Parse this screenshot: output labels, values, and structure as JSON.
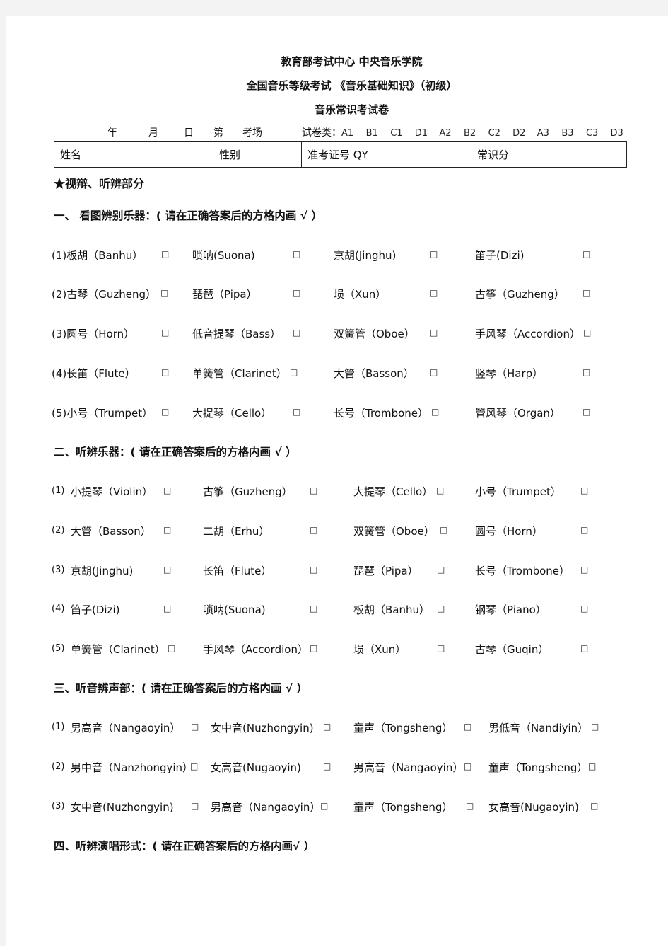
{
  "header": {
    "line1": "教育部考试中心  中央音乐学院",
    "line2": "全国音乐等级考试  《音乐基础知识》（初级）",
    "line3": "音乐常识考试卷"
  },
  "meta": {
    "year": "年",
    "month": "月",
    "day": "日",
    "di": "第",
    "exam_room": "考场",
    "paper_type_label": "试卷类：",
    "paper_codes": [
      "A1",
      "B1",
      "C1",
      "D1",
      "A2",
      "B2",
      "C2",
      "D2",
      "A3",
      "B3",
      "C3",
      "D3"
    ]
  },
  "info_table": {
    "name": "姓名",
    "gender": "性别",
    "ticket": "准考证号 QY",
    "score": "常识分"
  },
  "section_star": "★视辩、听辨部分",
  "checkbox": "□",
  "sections": [
    {
      "title": "一、 看图辨别乐器：( 请在正确答案后的方格内画  √  ）",
      "rows": [
        {
          "num": "(1)",
          "items": [
            "板胡（Banhu）",
            "唢呐(Suona)",
            "京胡(Jinghu)",
            "笛子(Dizi)"
          ]
        },
        {
          "num": "(2)",
          "items": [
            "古琴（Guzheng）",
            "琵琶（Pipa）",
            "埙（Xun）",
            "古筝（Guzheng）"
          ]
        },
        {
          "num": "(3)",
          "items": [
            "圆号（Horn）",
            "低音提琴（Bass）",
            "双簧管（Oboe）",
            "手风琴（Accordion）"
          ]
        },
        {
          "num": "(4)",
          "items": [
            "长笛（Flute）",
            "单簧管（Clarinet）",
            "大管（Basson）",
            "竖琴（Harp）"
          ]
        },
        {
          "num": "(5)",
          "items": [
            "小号（Trumpet）",
            "大提琴（Cello）",
            "长号（Trombone）",
            "管风琴（Organ）"
          ]
        }
      ]
    },
    {
      "title": "二、听辨乐器：( 请在正确答案后的方格内画  √    ）",
      "rows": [
        {
          "num": "(1)",
          "items": [
            "小提琴（Violin）",
            "古筝（Guzheng）",
            "大提琴（Cello）",
            "小号（Trumpet）"
          ]
        },
        {
          "num": "(2)",
          "items": [
            "大管（Basson）",
            "二胡（Erhu）",
            "双簧管（Oboe）",
            "圆号（Horn）"
          ]
        },
        {
          "num": "(3)",
          "items": [
            "京胡(Jinghu)",
            "长笛（Flute）",
            "琵琶（Pipa）",
            "长号（Trombone）"
          ]
        },
        {
          "num": "(4)",
          "items": [
            "笛子(Dizi)",
            "唢呐(Suona)",
            "板胡（Banhu）",
            "钢琴（Piano）"
          ]
        },
        {
          "num": "(5)",
          "items": [
            "单簧管（Clarinet）",
            "手风琴（Accordion）",
            "埙（Xun）",
            "古琴（Guqin）"
          ]
        }
      ]
    },
    {
      "title": "三、听音辨声部：( 请在正确答案后的方格内画  √    ）",
      "rows": [
        {
          "num": "(1)",
          "items": [
            "男高音（Nangaoyin）",
            "女中音(Nuzhongyin)",
            "童声（Tongsheng）",
            "男低音（Nandiyin）"
          ]
        },
        {
          "num": "(2)",
          "items": [
            "男中音（Nanzhongyin）",
            "女高音(Nugaoyin)",
            "男高音（Nangaoyin）",
            "童声（Tongsheng）"
          ]
        },
        {
          "num": "(3)",
          "items": [
            "女中音(Nuzhongyin)",
            "男高音（Nangaoyin）",
            "童声（Tongsheng）",
            "女高音(Nugaoyin)"
          ]
        }
      ]
    },
    {
      "title": "四、听辨演唱形式：( 请在正确答案后的方格内画√     ）",
      "rows": []
    }
  ]
}
